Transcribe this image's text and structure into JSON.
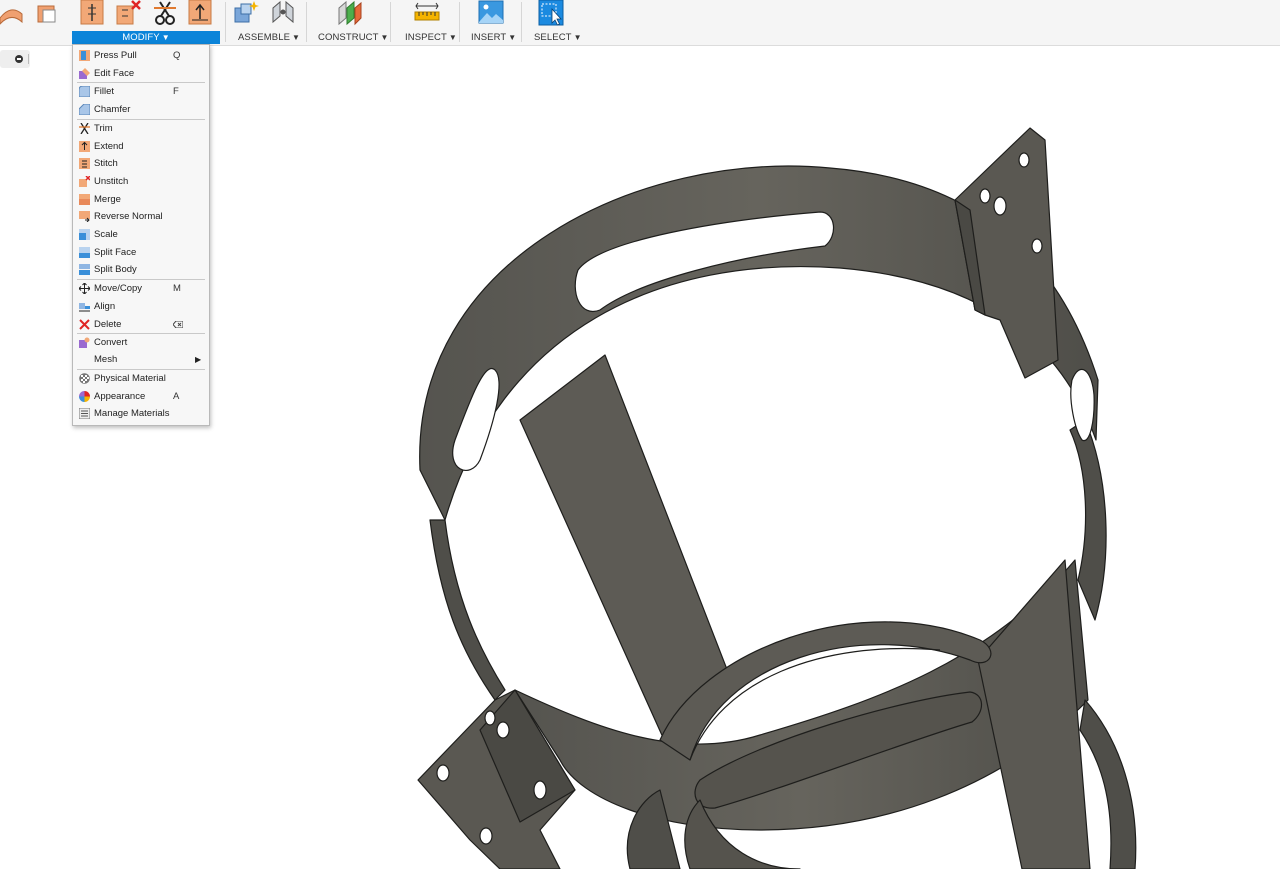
{
  "toolbar": {
    "groups": [
      {
        "label": "MODIFY",
        "active": true
      },
      {
        "label": "ASSEMBLE",
        "active": false
      },
      {
        "label": "CONSTRUCT",
        "active": false
      },
      {
        "label": "INSPECT",
        "active": false
      },
      {
        "label": "INSERT",
        "active": false
      },
      {
        "label": "SELECT",
        "active": false
      }
    ],
    "caret": "▼",
    "icons": [
      "loft-icon",
      "shell-icon",
      "press-pull-icon",
      "unstitch-icon",
      "trim-icon",
      "extend-icon",
      "new-component-icon",
      "joint-icon",
      "offset-plane-icon",
      "measure-icon",
      "insert-image-icon",
      "select-icon"
    ],
    "accent": "#0b84d9"
  },
  "modify_menu": {
    "items": [
      {
        "label": "Press Pull",
        "shortcut": "Q",
        "icon": "press-pull-icon"
      },
      {
        "label": "Edit Face",
        "shortcut": "",
        "icon": "edit-face-icon"
      },
      {
        "label": "Fillet",
        "shortcut": "F",
        "icon": "fillet-icon"
      },
      {
        "label": "Chamfer",
        "shortcut": "",
        "icon": "chamfer-icon"
      },
      {
        "label": "Trim",
        "shortcut": "",
        "icon": "trim-icon"
      },
      {
        "label": "Extend",
        "shortcut": "",
        "icon": "extend-icon"
      },
      {
        "label": "Stitch",
        "shortcut": "",
        "icon": "stitch-icon"
      },
      {
        "label": "Unstitch",
        "shortcut": "",
        "icon": "unstitch-icon"
      },
      {
        "label": "Merge",
        "shortcut": "",
        "icon": "merge-icon"
      },
      {
        "label": "Reverse Normal",
        "shortcut": "",
        "icon": "reverse-normal-icon"
      },
      {
        "label": "Scale",
        "shortcut": "",
        "icon": "scale-icon"
      },
      {
        "label": "Split Face",
        "shortcut": "",
        "icon": "split-face-icon"
      },
      {
        "label": "Split Body",
        "shortcut": "",
        "icon": "split-body-icon"
      },
      {
        "label": "Move/Copy",
        "shortcut": "M",
        "icon": "move-icon"
      },
      {
        "label": "Align",
        "shortcut": "",
        "icon": "align-icon"
      },
      {
        "label": "Delete",
        "shortcut": "",
        "icon": "delete-icon",
        "shortcut_icon": "backspace-key-icon"
      },
      {
        "label": "Convert",
        "shortcut": "",
        "icon": "convert-icon"
      },
      {
        "label": "Mesh",
        "shortcut": "",
        "icon": "",
        "submenu": true
      },
      {
        "label": "Physical Material",
        "shortcut": "",
        "icon": "physical-material-icon"
      },
      {
        "label": "Appearance",
        "shortcut": "A",
        "icon": "appearance-icon"
      },
      {
        "label": "Manage Materials",
        "shortcut": "",
        "icon": "manage-materials-icon"
      }
    ],
    "submenu_arrow": "▶"
  },
  "viewport": {
    "model_color": "#5e5c56",
    "edge_color": "#1e1e1c"
  }
}
